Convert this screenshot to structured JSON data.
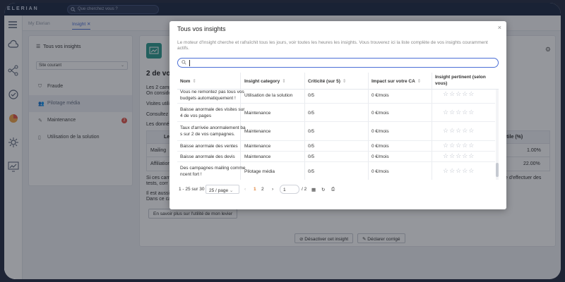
{
  "app": {
    "logo": "ELERIAN",
    "search_placeholder": "Que cherchez vous ?"
  },
  "tabs": [
    {
      "label": "My Elerian"
    },
    {
      "label": "Insight"
    }
  ],
  "sidebar": {
    "title": "Tous vos insights",
    "scope": "Site courant",
    "items": [
      {
        "label": "Fraude"
      },
      {
        "label": "Pilotage média"
      },
      {
        "label": "Maintenance",
        "badge": "2"
      },
      {
        "label": "Utilisation de la solution"
      }
    ]
  },
  "background": {
    "heading": "2 de vo",
    "lines": [
      "Les 2 camp",
      "On conside",
      "Visites utili",
      "Consultez",
      "Les donné"
    ],
    "table_header": [
      "Le",
      "utile (%)"
    ],
    "rows": [
      {
        "label": "Mailing",
        "value": "1.00%"
      },
      {
        "label": "Affiliation",
        "value": "22.00%"
      }
    ],
    "para1": [
      "Si ces cam",
      "tests, corr"
    ],
    "para1_right": "e d'effectuer des",
    "para2": [
      "Il est aussi",
      "Dans ce ca"
    ],
    "learn_more": "En savoir plus sur l'utilité de mon levier",
    "deactivate": "Désactiver cet insight",
    "declare_fixed": "Déclarer corrigé"
  },
  "modal": {
    "title": "Tous vos insights",
    "close": "×",
    "description": "Le moteur d'Insight cherche et rafraîchit tous les jours, voir toutes les heures les insights. Vous trouverez ici la liste complète de vos insights couramment actifs.",
    "columns": [
      "Nom",
      "Insight category",
      "Criticité (sur 5)",
      "Impact sur votre CA",
      "Insight pertinent (selon vous)"
    ],
    "rows": [
      {
        "name": [
          "Vous ne remontez pas tous vos",
          "budgets automatiquement !"
        ],
        "category": "Utilisation de la solution",
        "criticite": "0/5",
        "impact": "0 €/mois"
      },
      {
        "name": [
          "Baisse anormale des visites sur",
          "4 de vos pages"
        ],
        "category": "Maintenance",
        "criticite": "0/5",
        "impact": "0 €/mois"
      },
      {
        "name": [
          "Taux d'arrivée anormalement ba",
          "s sur 2 de vos campagnes."
        ],
        "category": "Maintenance",
        "criticite": "0/5",
        "impact": "0 €/mois"
      },
      {
        "name": [
          "Baisse anormale des ventes"
        ],
        "category": "Maintenance",
        "criticite": "0/5",
        "impact": "0 €/mois"
      },
      {
        "name": [
          "Baisse anormale des devis"
        ],
        "category": "Maintenance",
        "criticite": "0/5",
        "impact": "0 €/mois"
      },
      {
        "name": [
          "Des campagnes mailing comme",
          "ncent fort !"
        ],
        "category": "Pilotage média",
        "criticite": "0/5",
        "impact": "0 €/mois"
      }
    ],
    "stars": "☆☆☆☆☆",
    "pager": {
      "range": "1 - 25 sur 30",
      "per_page": "25 / page",
      "page1": "1",
      "page2": "2",
      "current": "1",
      "total": "/ 2"
    }
  }
}
